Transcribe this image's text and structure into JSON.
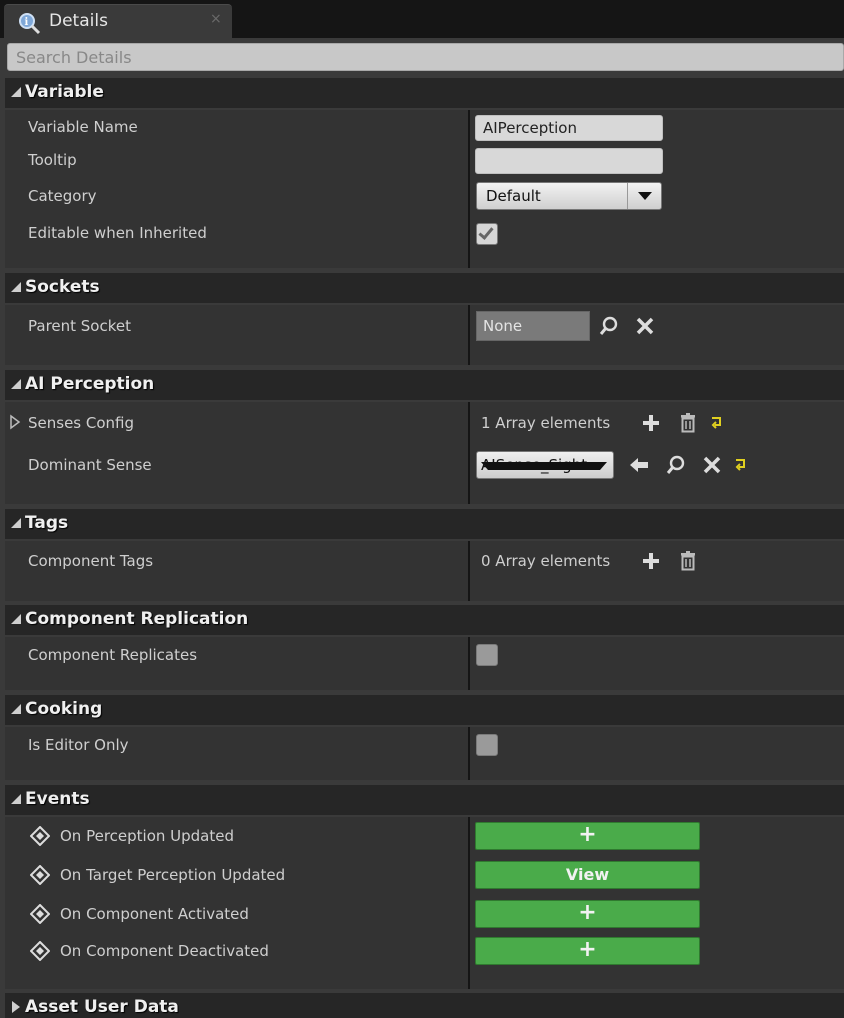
{
  "tab": {
    "label": "Details",
    "close": "×"
  },
  "search": {
    "placeholder": "Search Details"
  },
  "sections": {
    "variable": {
      "title": "Variable",
      "variable_name_label": "Variable Name",
      "variable_name_value": "AIPerception",
      "tooltip_label": "Tooltip",
      "tooltip_value": "",
      "category_label": "Category",
      "category_value": "Default",
      "editable_label": "Editable when Inherited",
      "editable_checked": true
    },
    "sockets": {
      "title": "Sockets",
      "parent_socket_label": "Parent Socket",
      "parent_socket_value": "None"
    },
    "ai_perception": {
      "title": "AI Perception",
      "senses_config_label": "Senses Config",
      "senses_config_value": "1 Array elements",
      "dominant_sense_label": "Dominant Sense",
      "dominant_sense_value": "AISense_Sight"
    },
    "tags": {
      "title": "Tags",
      "component_tags_label": "Component Tags",
      "component_tags_value": "0 Array elements"
    },
    "replication": {
      "title": "Component Replication",
      "replicates_label": "Component Replicates",
      "replicates_checked": false
    },
    "cooking": {
      "title": "Cooking",
      "editor_only_label": "Is Editor Only",
      "editor_only_checked": false
    },
    "events": {
      "title": "Events",
      "items": [
        {
          "label": "On Perception Updated",
          "button": "+"
        },
        {
          "label": "On Target Perception Updated",
          "button": "View"
        },
        {
          "label": "On Component Activated",
          "button": "+"
        },
        {
          "label": "On Component Deactivated",
          "button": "+"
        }
      ]
    },
    "asset_user_data": {
      "title": "Asset User Data"
    }
  },
  "colors": {
    "event_button": "#4aab4a",
    "reset_arrow": "#e0d020",
    "header_bg": "#262626",
    "row_bg": "#333333"
  }
}
